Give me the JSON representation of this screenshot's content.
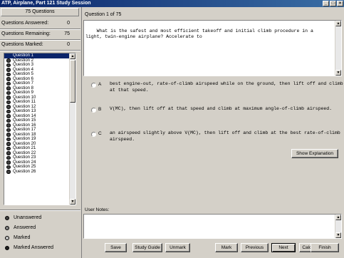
{
  "window": {
    "title": "ATP, Airplane, Part 121 Study Session"
  },
  "sidebar": {
    "header": "75 Questions",
    "stats": [
      {
        "label": "Questions Answered:",
        "value": "0"
      },
      {
        "label": "Questions Remaining:",
        "value": "75"
      },
      {
        "label": "Questions Marked:",
        "value": "0"
      }
    ],
    "questions": [
      "Question 1",
      "Question 2",
      "Question 3",
      "Question 4",
      "Question 5",
      "Question 6",
      "Question 7",
      "Question 8",
      "Question 9",
      "Question 10",
      "Question 11",
      "Question 12",
      "Question 13",
      "Question 14",
      "Question 15",
      "Question 16",
      "Question 17",
      "Question 18",
      "Question 19",
      "Question 20",
      "Question 21",
      "Question 22",
      "Question 23",
      "Question 24",
      "Question 25",
      "Question 26"
    ],
    "selected_index": 0,
    "legend": [
      {
        "label": "Unanswered",
        "color": "#404040"
      },
      {
        "label": "Answered",
        "color": "#808080"
      },
      {
        "label": "Marked",
        "color": "#c0c0c0"
      },
      {
        "label": "Marked Answered",
        "color": "#202020"
      }
    ]
  },
  "main": {
    "question_number": "Question 1 of 75",
    "question_text": "What is the safest and most efficient takeoff and initial climb procedure in a light, twin-engine airplane? Accelerate to",
    "choices": [
      {
        "letter": "A",
        "text": "best engine-out, rate-of-climb airspeed while on the ground, then lift off and climb at that speed."
      },
      {
        "letter": "B",
        "text": "V(MC), then lift off at that speed and climb at maximum angle-of-climb airspeed."
      },
      {
        "letter": "C",
        "text": "an airspeed slightly above V(MC), then lift off and climb at the best rate-of-climb airspeed."
      }
    ],
    "show_explanation": "Show Explanation",
    "notes_label": "User Notes:",
    "notes_value": ""
  },
  "toolbar": {
    "save": "Save",
    "study_guide": "Study Guide",
    "unmark": "Unmark",
    "mark": "Mark",
    "previous": "Previous",
    "next": "Next",
    "calculator": "Calculator",
    "finish": "Finish"
  }
}
